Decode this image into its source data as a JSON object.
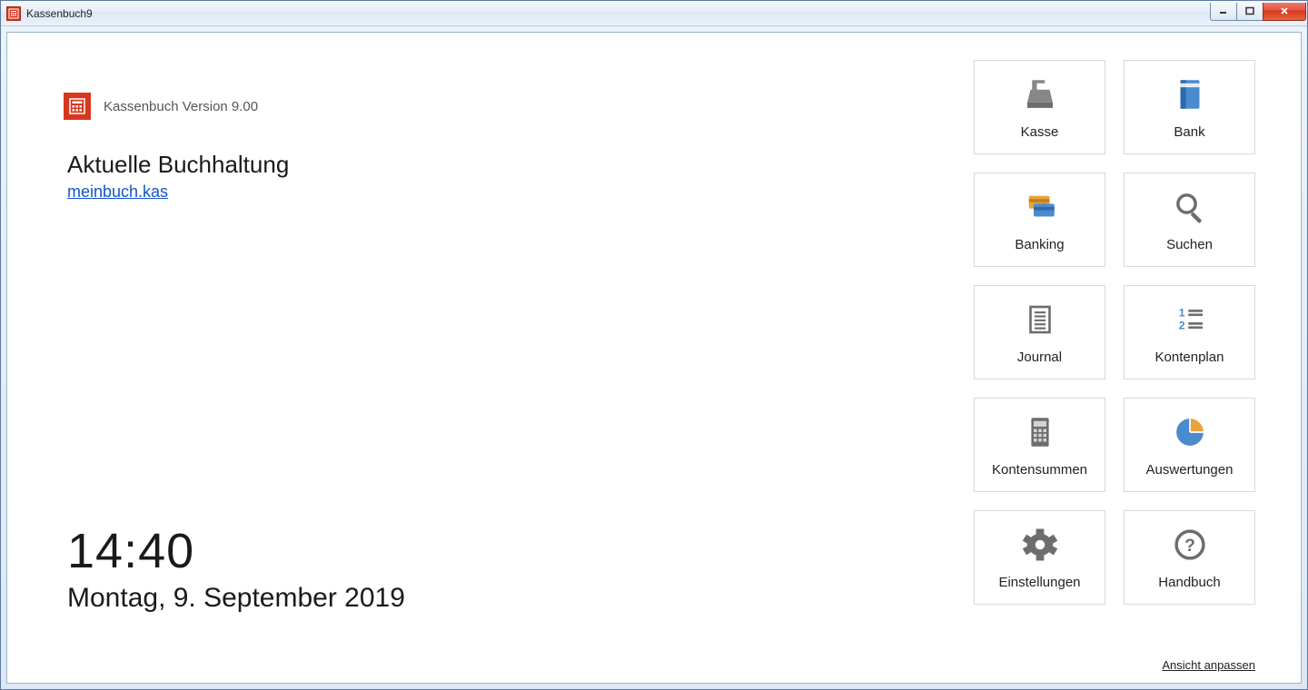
{
  "window": {
    "title": "Kassenbuch9"
  },
  "header": {
    "version": "Kassenbuch Version 9.00"
  },
  "current": {
    "heading": "Aktuelle Buchhaltung",
    "file": "meinbuch.kas"
  },
  "clock": {
    "time": "14:40",
    "date": "Montag, 9. September 2019"
  },
  "tiles": {
    "kasse": "Kasse",
    "bank": "Bank",
    "banking": "Banking",
    "suchen": "Suchen",
    "journal": "Journal",
    "kontenplan": "Kontenplan",
    "kontensummen": "Kontensummen",
    "auswertungen": "Auswertungen",
    "einstellungen": "Einstellungen",
    "handbuch": "Handbuch"
  },
  "footer": {
    "customize": "Ansicht anpassen"
  }
}
